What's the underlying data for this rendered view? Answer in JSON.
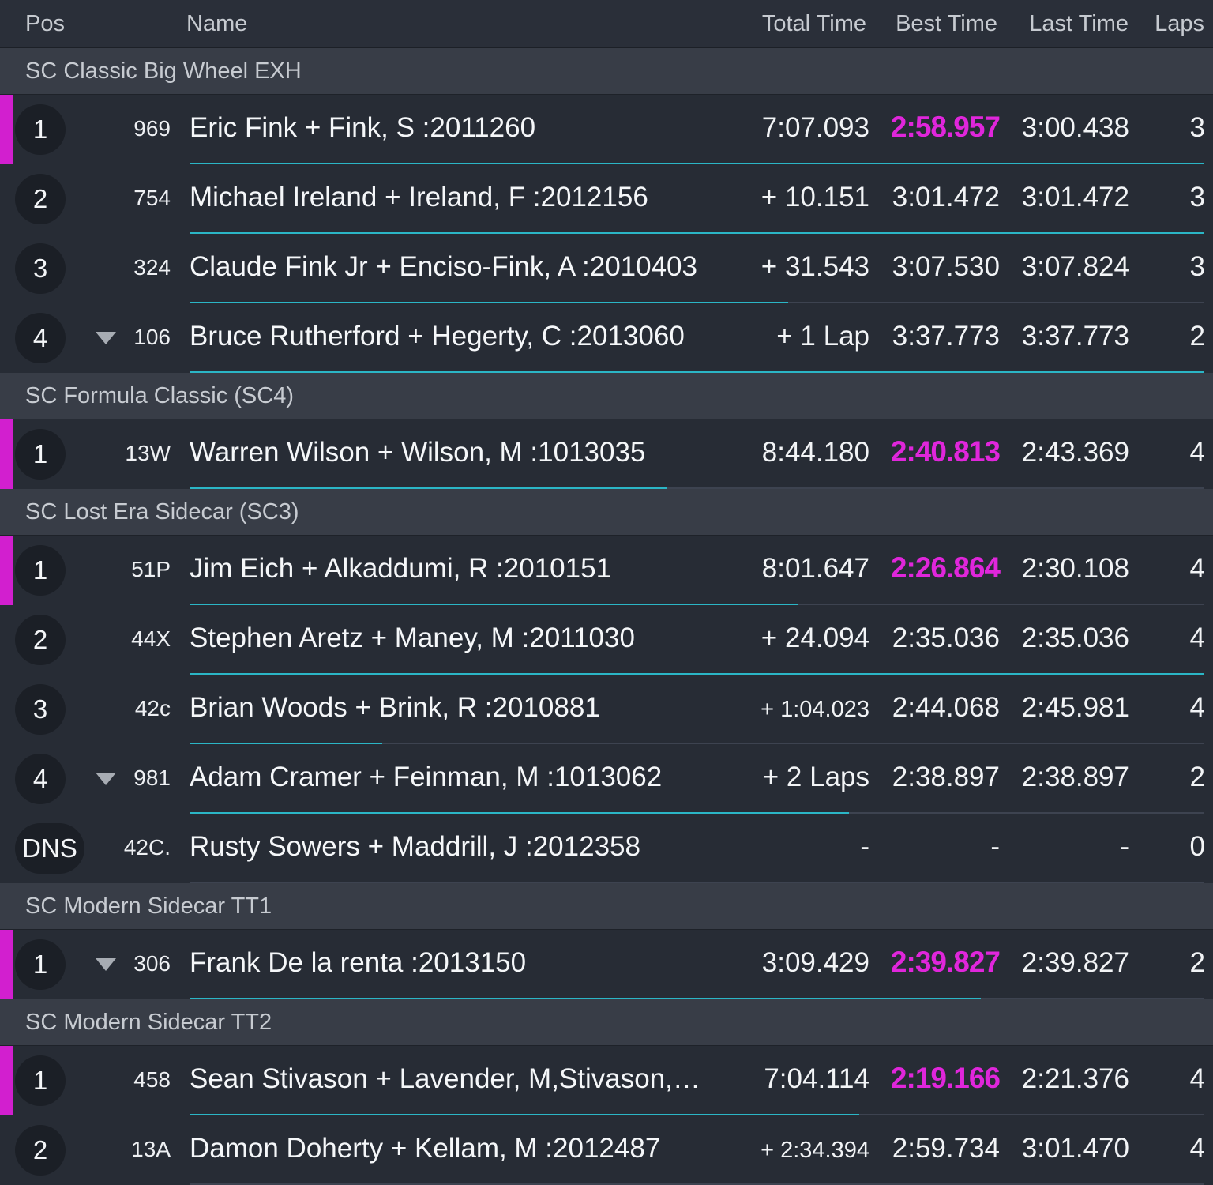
{
  "columns": {
    "pos": "Pos",
    "name": "Name",
    "total": "Total Time",
    "best": "Best Time",
    "last": "Last Time",
    "laps": "Laps"
  },
  "colors": {
    "background": "#282d37",
    "section": "#383d47",
    "leader": "#d21fcf",
    "best_lap": "#e026db",
    "progress": "#2bb6c6"
  },
  "icons": {
    "lost_position": "triangle-down-icon"
  },
  "classes": [
    {
      "title": "SC Classic Big Wheel EXH",
      "rows": [
        {
          "pos": "1",
          "num": "969",
          "name": "Eric Fink + Fink, S :2011260",
          "total": "7:07.093",
          "best": "2:58.957",
          "last": "3:00.438",
          "laps": "3",
          "leader": true,
          "fastest": true,
          "down": false,
          "progress": 1.0
        },
        {
          "pos": "2",
          "num": "754",
          "name": "Michael Ireland + Ireland, F :2012156",
          "total": "+ 10.151",
          "best": "3:01.472",
          "last": "3:01.472",
          "laps": "3",
          "leader": false,
          "fastest": false,
          "down": false,
          "progress": 1.0
        },
        {
          "pos": "3",
          "num": "324",
          "name": "Claude Fink Jr + Enciso-Fink, A :2010403",
          "total": "+ 31.543",
          "best": "3:07.530",
          "last": "3:07.824",
          "laps": "3",
          "leader": false,
          "fastest": false,
          "down": false,
          "progress": 0.59
        },
        {
          "pos": "4",
          "num": "106",
          "name": "Bruce Rutherford + Hegerty, C :2013060",
          "total": "+ 1 Lap",
          "best": "3:37.773",
          "last": "3:37.773",
          "laps": "2",
          "leader": false,
          "fastest": false,
          "down": true,
          "progress": 1.0
        }
      ]
    },
    {
      "title": "SC Formula Classic (SC4)",
      "rows": [
        {
          "pos": "1",
          "num": "13W",
          "name": "Warren Wilson + Wilson, M :1013035",
          "total": "8:44.180",
          "best": "2:40.813",
          "last": "2:43.369",
          "laps": "4",
          "leader": true,
          "fastest": true,
          "down": false,
          "progress": 0.47
        }
      ]
    },
    {
      "title": "SC Lost Era Sidecar (SC3)",
      "rows": [
        {
          "pos": "1",
          "num": "51P",
          "name": "Jim Eich + Alkaddumi, R :2010151",
          "total": "8:01.647",
          "best": "2:26.864",
          "last": "2:30.108",
          "laps": "4",
          "leader": true,
          "fastest": true,
          "down": false,
          "progress": 0.6
        },
        {
          "pos": "2",
          "num": "44X",
          "name": "Stephen Aretz + Maney, M :2011030",
          "total": "+ 24.094",
          "best": "2:35.036",
          "last": "2:35.036",
          "laps": "4",
          "leader": false,
          "fastest": false,
          "down": false,
          "progress": 1.0
        },
        {
          "pos": "3",
          "num": "42c",
          "name": "Brian Woods + Brink, R :2010881",
          "total": "+ 1:04.023",
          "best": "2:44.068",
          "last": "2:45.981",
          "laps": "4",
          "leader": false,
          "fastest": false,
          "down": false,
          "progress": 0.19,
          "small_total": true
        },
        {
          "pos": "4",
          "num": "981",
          "name": "Adam Cramer + Feinman, M :1013062",
          "total": "+ 2 Laps",
          "best": "2:38.897",
          "last": "2:38.897",
          "laps": "2",
          "leader": false,
          "fastest": false,
          "down": true,
          "progress": 0.65
        },
        {
          "pos": "DNS",
          "num": "42C.",
          "name": "Rusty Sowers + Maddrill, J :2012358",
          "total": "-",
          "best": "-",
          "last": "-",
          "laps": "0",
          "leader": false,
          "fastest": false,
          "down": false,
          "progress": 0
        }
      ]
    },
    {
      "title": "SC Modern Sidecar TT1",
      "rows": [
        {
          "pos": "1",
          "num": "306",
          "name": "Frank De la renta :2013150",
          "total": "3:09.429",
          "best": "2:39.827",
          "last": "2:39.827",
          "laps": "2",
          "leader": true,
          "fastest": true,
          "down": true,
          "progress": 0.78
        }
      ]
    },
    {
      "title": "SC Modern Sidecar TT2",
      "rows": [
        {
          "pos": "1",
          "num": "458",
          "name": "Sean Stivason + Lavender, M,Stivason,…",
          "total": "7:04.114",
          "best": "2:19.166",
          "last": "2:21.376",
          "laps": "4",
          "leader": true,
          "fastest": true,
          "down": false,
          "progress": 0.66
        },
        {
          "pos": "2",
          "num": "13A",
          "name": "Damon Doherty + Kellam, M :2012487",
          "total": "+ 2:34.394",
          "best": "2:59.734",
          "last": "3:01.470",
          "laps": "4",
          "leader": false,
          "fastest": false,
          "down": false,
          "progress": 0,
          "small_total": true
        }
      ]
    }
  ]
}
